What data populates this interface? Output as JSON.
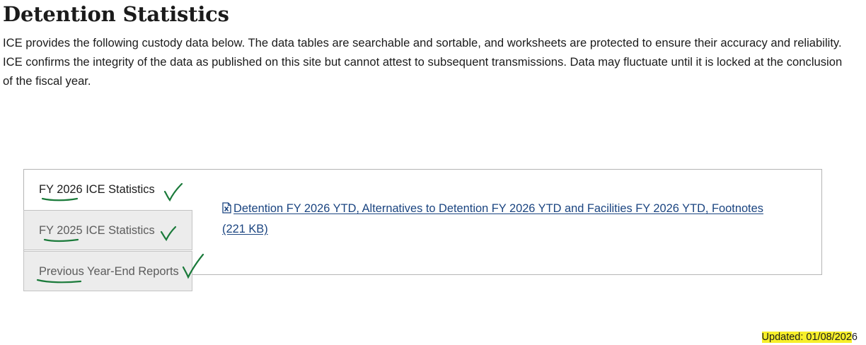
{
  "page": {
    "title": "Detention Statistics",
    "intro": "ICE provides the following custody data below. The data tables are searchable and sortable, and worksheets are protected to ensure their accuracy and reliability. ICE confirms the integrity of the data as published on this site but cannot attest to subsequent transmissions. Data may fluctuate until it is locked at the conclusion of the fiscal year."
  },
  "tabs": [
    {
      "label": "FY 2026 ICE Statistics",
      "active": true
    },
    {
      "label": "FY 2025 ICE Statistics",
      "active": false
    },
    {
      "label": "Previous Year-End Reports",
      "active": false
    }
  ],
  "panel": {
    "link_text": "Detention FY 2026 YTD, Alternatives to Detention FY 2026 YTD and Facilities FY 2026 YTD, Footnotes (221 KB)",
    "link_icon": "excel-file-icon"
  },
  "footer": {
    "updated_label": "Updated: 01/08/202",
    "updated_suffix": "6"
  },
  "colors": {
    "link": "#1a4480",
    "annotation_green": "#1a7a3a",
    "highlight": "#f7ef2a"
  }
}
